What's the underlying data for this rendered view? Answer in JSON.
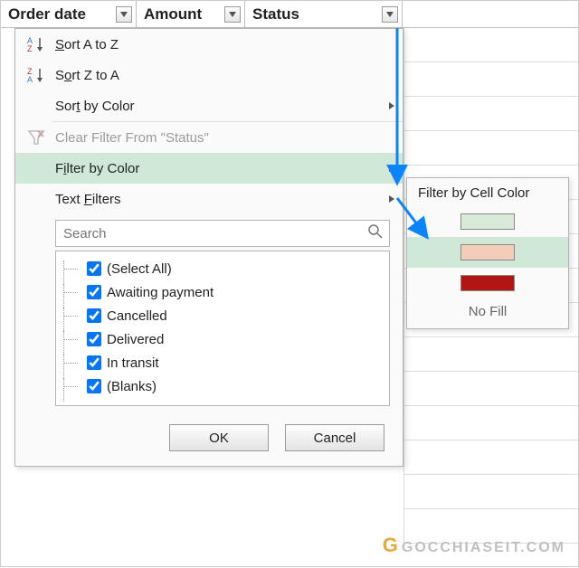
{
  "header": {
    "columns": [
      "Order date",
      "Amount",
      "Status"
    ]
  },
  "menu": {
    "sort_az": "Sort A to Z",
    "sort_za": "Sort Z to A",
    "sort_color": "Sort by Color",
    "clear_filter": "Clear Filter From \"Status\"",
    "filter_color": "Filter by Color",
    "text_filters": "Text Filters"
  },
  "search": {
    "placeholder": "Search"
  },
  "checklist": [
    "(Select All)",
    "Awaiting payment",
    "Cancelled",
    "Delivered",
    "In transit",
    "(Blanks)"
  ],
  "buttons": {
    "ok": "OK",
    "cancel": "Cancel"
  },
  "flyout": {
    "title": "Filter by Cell Color",
    "swatches": [
      "#d9ead9",
      "#f4cdb8",
      "#b31414"
    ],
    "nofill": "No Fill"
  },
  "watermark": "GOCCHIASEIT.COM"
}
